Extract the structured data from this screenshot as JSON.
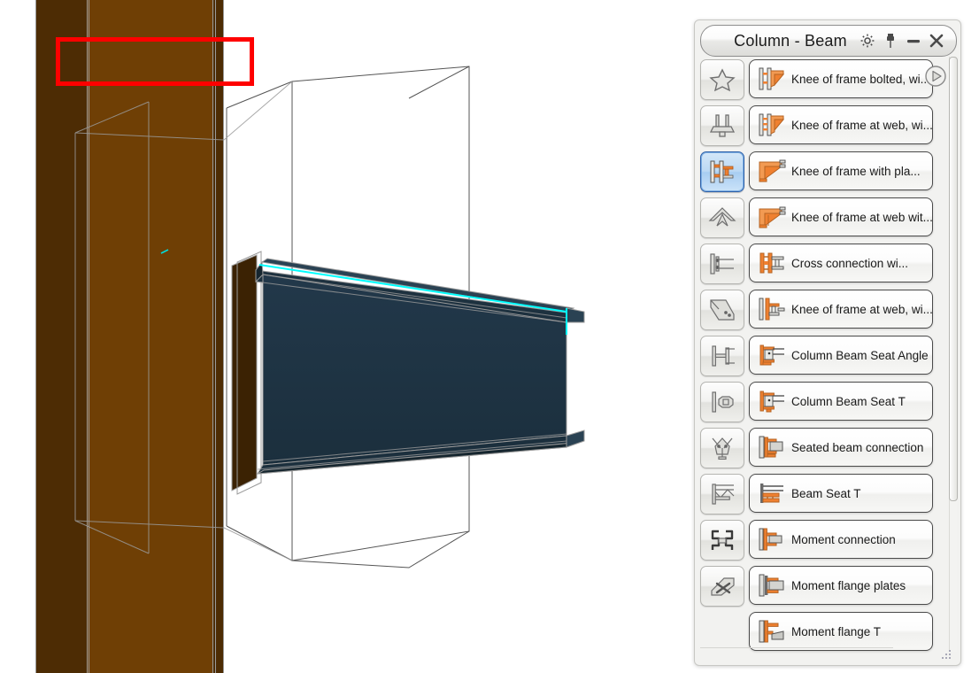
{
  "panel": {
    "title": "Column - Beam",
    "titlebar_buttons": [
      {
        "name": "settings-gear-icon",
        "label": "Settings"
      },
      {
        "name": "pin-icon",
        "label": "Pin"
      },
      {
        "name": "minimize-icon",
        "label": "Minimize"
      },
      {
        "name": "close-icon",
        "label": "Close"
      }
    ]
  },
  "rail": {
    "items": [
      {
        "name": "favorites-star-icon",
        "label": "Favorites",
        "selected": false
      },
      {
        "name": "base-plate-icon",
        "label": "Column base plates",
        "selected": false
      },
      {
        "name": "column-beam-icon",
        "label": "Column - Beam",
        "selected": true
      },
      {
        "name": "apex-icon",
        "label": "Apex connections",
        "selected": false
      },
      {
        "name": "beam-beam-icon",
        "label": "Beam - Beam",
        "selected": false
      },
      {
        "name": "bracing-plate-icon",
        "label": "Bracing gusset plate",
        "selected": false
      },
      {
        "name": "beam-splice-icon",
        "label": "Beam splice",
        "selected": false
      },
      {
        "name": "column-splice-icon",
        "label": "Column splice",
        "selected": false
      },
      {
        "name": "bracing-connection-icon",
        "label": "Bracing connections",
        "selected": false
      },
      {
        "name": "truss-icon",
        "label": "Truss connections",
        "selected": false
      },
      {
        "name": "stairs-icon",
        "label": "Stairs and railings",
        "selected": false
      },
      {
        "name": "misc-tools-icon",
        "label": "Miscellaneous",
        "selected": false
      }
    ]
  },
  "list": {
    "items": [
      {
        "name": "knee-of-frame-bolted-with-haunch",
        "label": "Knee of frame bolted, wi...",
        "icon": "knee-frame-bolted-icon",
        "selected": true
      },
      {
        "name": "knee-of-frame-at-web-1",
        "label": "Knee of frame at web, wi...",
        "icon": "knee-frame-web-icon",
        "selected": false
      },
      {
        "name": "knee-of-frame-with-plate",
        "label": "Knee of frame with pla...",
        "icon": "knee-frame-plate-icon",
        "selected": false
      },
      {
        "name": "knee-of-frame-at-web-with",
        "label": "Knee of frame at web wit...",
        "icon": "knee-frame-web-plate-icon",
        "selected": false
      },
      {
        "name": "cross-connection-with",
        "label": "Cross connection wi...",
        "icon": "cross-connection-icon",
        "selected": false
      },
      {
        "name": "knee-of-frame-at-web-2",
        "label": "Knee of frame at web, wi...",
        "icon": "knee-frame-web2-icon",
        "selected": false
      },
      {
        "name": "column-beam-seat-angle",
        "label": "Column Beam Seat Angle",
        "icon": "column-beam-seat-angle-icon",
        "selected": false
      },
      {
        "name": "column-beam-seat-t",
        "label": "Column Beam Seat T",
        "icon": "column-beam-seat-t-icon",
        "selected": false
      },
      {
        "name": "seated-beam-connection",
        "label": "Seated beam connection",
        "icon": "seated-beam-icon",
        "selected": false
      },
      {
        "name": "beam-seat-t",
        "label": "Beam Seat T",
        "icon": "beam-seat-t-icon",
        "selected": false
      },
      {
        "name": "moment-connection",
        "label": "Moment connection",
        "icon": "moment-connection-icon",
        "selected": false
      },
      {
        "name": "moment-flange-plates",
        "label": "Moment flange plates",
        "icon": "moment-flange-plates-icon",
        "selected": false
      },
      {
        "name": "moment-flange-t",
        "label": "Moment flange T",
        "icon": "moment-flange-t-icon",
        "selected": false
      }
    ]
  },
  "colors": {
    "selection_rect": "#ff0000",
    "column_web": "#6f3f05",
    "column_flange": "#4d2c04",
    "beam_web": "#1e3342",
    "beam_flange": "#16262f",
    "highlight_edge": "#00ffff",
    "wire_edge": "#9a9a9a",
    "accent_orange": "#ef8030",
    "panel_bg": "#f2f2f0",
    "rail_selected": "#2b5fa8"
  },
  "viewport": {
    "name": "3d-model-viewport",
    "scene": "steel column to beam connection, brown column with dark blue I-beam and cyan selected edge"
  }
}
